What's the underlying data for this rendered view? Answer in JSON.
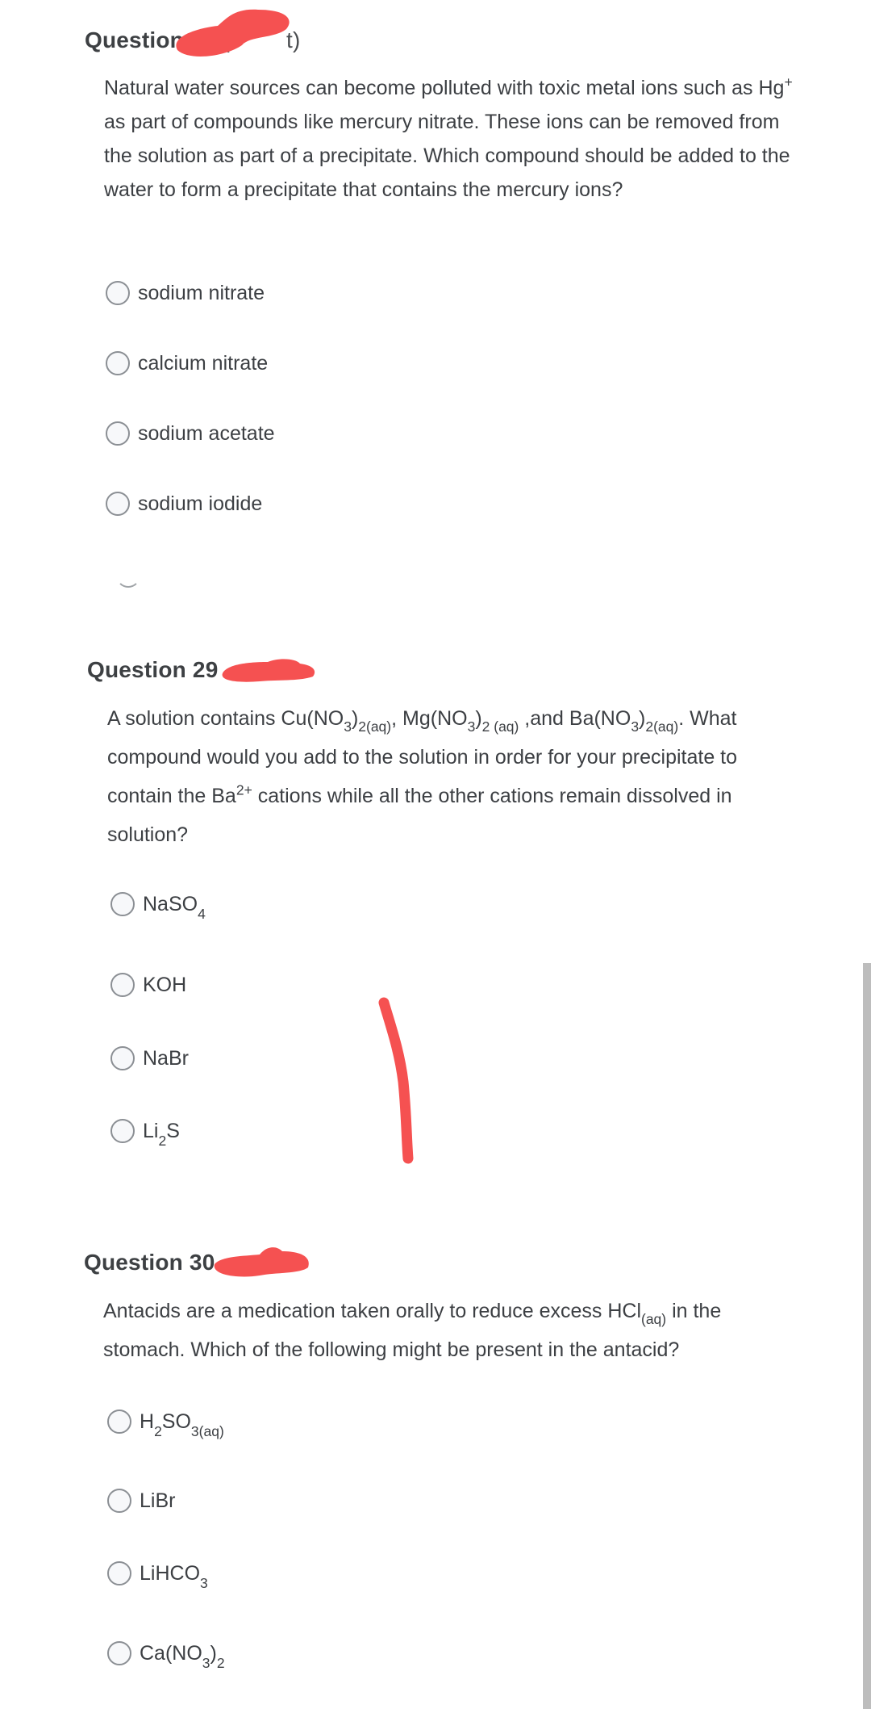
{
  "questions": [
    {
      "number_label": "Question 28",
      "points_label_visible": "(",
      "points_label_tail": "t)",
      "text_parts": {
        "p1": "Natural water sources can become polluted with toxic metal ions such as Hg",
        "sup1": "+",
        "p2": " as part of compounds like mercury nitrate.  These ions can be removed from the solution as part of a precipitate.  Which compound should be added to the water to form a precipitate that contains the mercury ions?"
      },
      "answers": [
        {
          "label": "sodium nitrate",
          "selected": false
        },
        {
          "label": "calcium nitrate",
          "selected": false
        },
        {
          "label": "sodium acetate",
          "selected": false
        },
        {
          "label": "sodium iodide",
          "selected": false
        }
      ]
    },
    {
      "number_label": "Question 29",
      "text_parts": {
        "p1": "A solution contains Cu(NO",
        "s1": "3",
        "p2": ")",
        "s2": "2(aq)",
        "p3": ", Mg(NO",
        "s3": "3",
        "p4": ")",
        "s4": "2 (aq)",
        "p5": " ,and Ba(NO",
        "s5": "3",
        "p6": ")",
        "s6": "2(aq)",
        "p7": ". What compound would you add to the solution in order for your precipitate to contain the Ba",
        "sup1": "2+",
        "p8": " cations while all the other cations remain dissolved in solution?"
      },
      "answers": [
        {
          "base": "NaSO",
          "sub": "4",
          "tail": "",
          "selected": false
        },
        {
          "base": "KOH",
          "sub": "",
          "tail": "",
          "selected": false
        },
        {
          "base": "NaBr",
          "sub": "",
          "tail": "",
          "selected": false
        },
        {
          "base": "Li",
          "sub": "2",
          "tail": "S",
          "selected": false
        }
      ]
    },
    {
      "number_label": "Question 30",
      "text_parts": {
        "p1": "Antacids are a medication taken orally to reduce excess HCl",
        "s1": "(aq)",
        "p2": " in the stomach. Which of the following might be present in the antacid?"
      },
      "answers": [
        {
          "parts": [
            "H",
            "2",
            "SO",
            "3(aq)",
            ""
          ],
          "selected": false
        },
        {
          "parts": [
            "LiBr",
            "",
            "",
            "",
            ""
          ],
          "selected": false
        },
        {
          "parts": [
            "LiHCO",
            "3",
            "",
            "",
            ""
          ],
          "selected": false
        },
        {
          "parts": [
            "Ca(NO",
            "3",
            ")",
            "2",
            ""
          ],
          "selected": false
        }
      ]
    }
  ],
  "annotations": {
    "redaction_color": "#f55151",
    "mark_color": "#f55151"
  }
}
